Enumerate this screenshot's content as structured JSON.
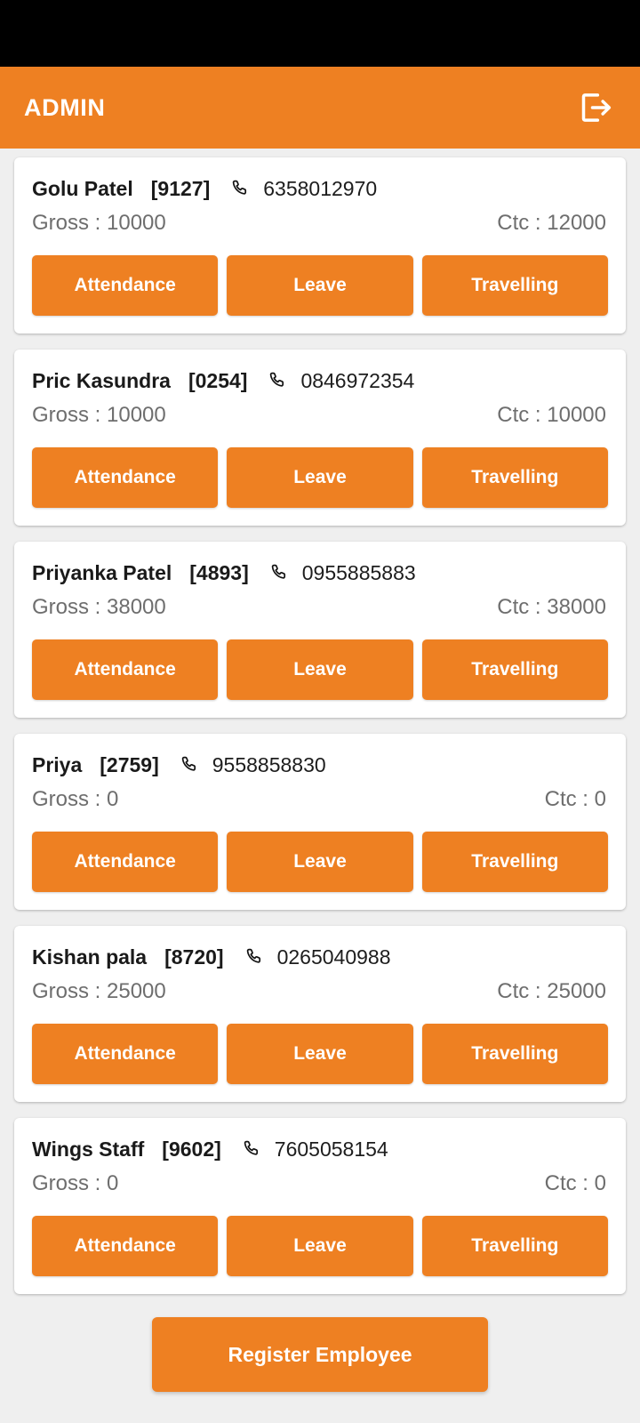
{
  "theme": {
    "accent": "#ee8022",
    "card_bg": "#ffffff",
    "page_bg": "#efefef",
    "status_bar_bg": "#000000",
    "muted_text": "#6e6e6e"
  },
  "status_bar": {
    "content": ""
  },
  "app_bar": {
    "title": "ADMIN",
    "logout_icon": "logout-icon"
  },
  "labels": {
    "gross_prefix": "Gross : ",
    "ctc_prefix": "Ctc : ",
    "phone_icon": "phone-icon",
    "attendance": "Attendance",
    "leave": "Leave",
    "travelling": "Travelling"
  },
  "employees": [
    {
      "name": "Golu Patel",
      "id": "[9127]",
      "phone": "6358012970",
      "gross": "Gross : 10000",
      "ctc": "Ctc : 12000",
      "actions": [
        "Attendance",
        "Leave",
        "Travelling"
      ]
    },
    {
      "name": "Pric Kasundra",
      "id": "[0254]",
      "phone": "0846972354",
      "gross": "Gross : 10000",
      "ctc": "Ctc : 10000",
      "actions": [
        "Attendance",
        "Leave",
        "Travelling"
      ]
    },
    {
      "name": "Priyanka Patel",
      "id": "[4893]",
      "phone": "0955885883",
      "gross": "Gross : 38000",
      "ctc": "Ctc : 38000",
      "actions": [
        "Attendance",
        "Leave",
        "Travelling"
      ]
    },
    {
      "name": "Priya",
      "id": "[2759]",
      "phone": "9558858830",
      "gross": "Gross : 0",
      "ctc": "Ctc : 0",
      "actions": [
        "Attendance",
        "Leave",
        "Travelling"
      ]
    },
    {
      "name": "Kishan pala",
      "id": "[8720]",
      "phone": "0265040988",
      "gross": "Gross : 25000",
      "ctc": "Ctc : 25000",
      "actions": [
        "Attendance",
        "Leave",
        "Travelling"
      ]
    },
    {
      "name": "Wings Staff",
      "id": "[9602]",
      "phone": "7605058154",
      "gross": "Gross : 0",
      "ctc": "Ctc : 0",
      "actions": [
        "Attendance",
        "Leave",
        "Travelling"
      ]
    }
  ],
  "footer": {
    "register_label": "Register Employee"
  }
}
